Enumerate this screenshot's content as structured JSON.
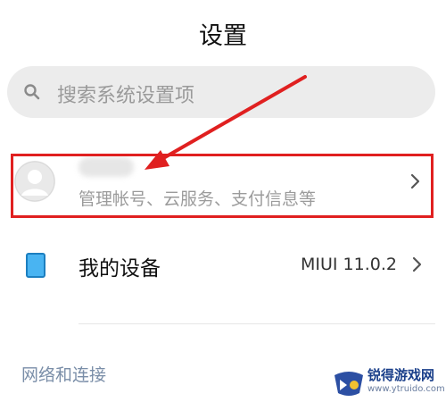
{
  "header": {
    "title": "设置"
  },
  "search": {
    "placeholder": "搜索系统设置项"
  },
  "account": {
    "subtitle": "管理帐号、云服务、支付信息等"
  },
  "device": {
    "label": "我的设备",
    "value": "MIUI 11.0.2"
  },
  "section": {
    "network_header": "网络和连接"
  },
  "watermark": {
    "text": "锐得游戏网",
    "url": "www.ytruido.com"
  },
  "colors": {
    "annotation": "#e02020",
    "device_icon": "#49b4f2",
    "section_header": "#7a8ea8"
  },
  "icons": [
    "search-icon",
    "avatar-icon",
    "chevron-right-icon",
    "phone-icon",
    "annotation-arrow",
    "watermark-logo"
  ]
}
